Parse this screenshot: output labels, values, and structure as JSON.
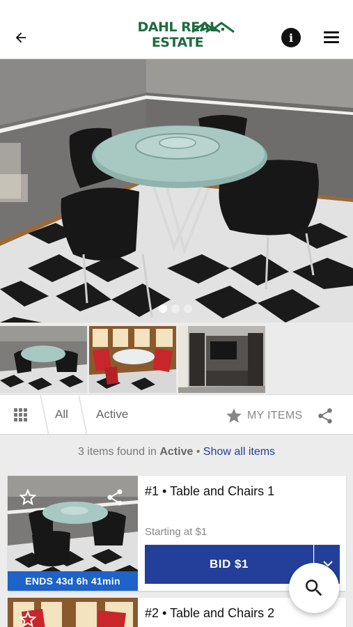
{
  "header": {
    "logo_text": "DAHL REAL ESTATE",
    "back_icon": "arrow-left-icon",
    "info_icon": "info-icon",
    "menu_icon": "hamburger-menu-icon",
    "info_glyph": "i"
  },
  "gallery": {
    "dots": 3,
    "active_dot": 0
  },
  "filter_bar": {
    "grid_icon": "grid-view-icon",
    "tabs": [
      {
        "label": "All"
      },
      {
        "label": "Active"
      }
    ],
    "my_items_label": "MY ITEMS",
    "star_icon": "star-icon",
    "share_icon": "share-icon"
  },
  "results": {
    "count_text": "3 items found in",
    "status": "Active",
    "separator": "•",
    "show_all_label": "Show all items"
  },
  "items": [
    {
      "title": "#1 • Table and Chairs 1",
      "starting_text": "Starting at $1",
      "ends_text": "ENDS 43d 6h 41min",
      "bid_label": "BID $1"
    },
    {
      "title": "#2 • Table and Chairs 2"
    }
  ],
  "colors": {
    "brand_green": "#1d6b3f",
    "primary_blue": "#233f99",
    "ends_blue": "#1d63c8",
    "link_blue": "#233f99"
  },
  "fab": {
    "icon": "search-icon"
  }
}
